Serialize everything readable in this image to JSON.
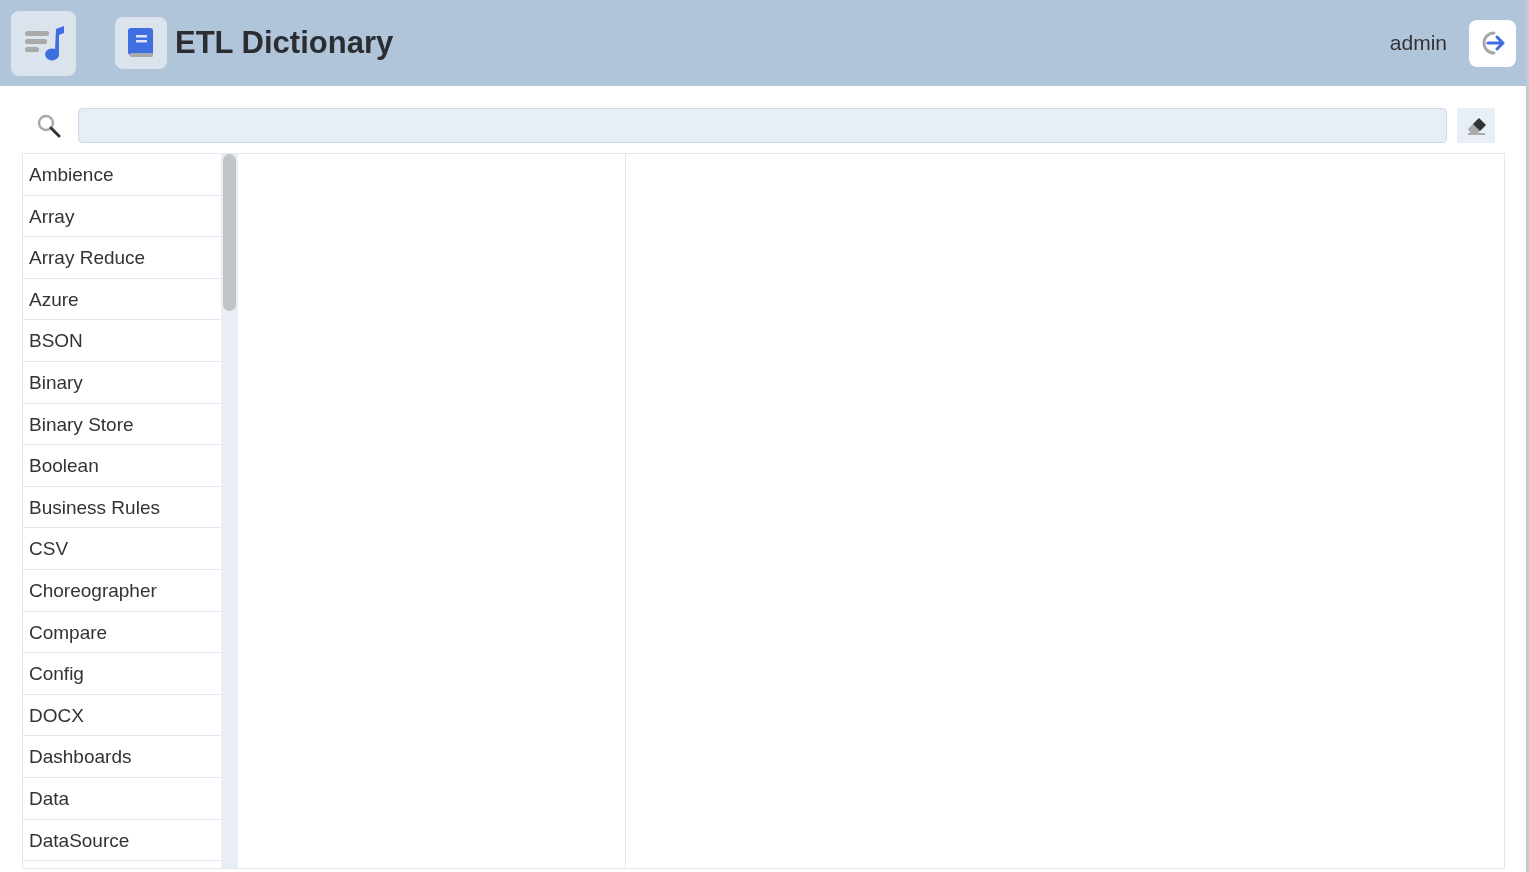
{
  "header": {
    "title": "ETL Dictionary",
    "user": "admin"
  },
  "items": [
    {
      "label": "Ambience",
      "selected": false
    },
    {
      "label": "Array",
      "selected": false
    },
    {
      "label": "Array Reduce",
      "selected": false
    },
    {
      "label": "Azure",
      "selected": false
    },
    {
      "label": "BSON",
      "selected": false
    },
    {
      "label": "Binary",
      "selected": false
    },
    {
      "label": "Binary Store",
      "selected": false
    },
    {
      "label": "Boolean",
      "selected": false
    },
    {
      "label": "Business Rules",
      "selected": false
    },
    {
      "label": "CSV",
      "selected": false
    },
    {
      "label": "Choreographer",
      "selected": false
    },
    {
      "label": "Compare",
      "selected": false
    },
    {
      "label": "Config",
      "selected": false
    },
    {
      "label": "DOCX",
      "selected": false
    },
    {
      "label": "Dashboards",
      "selected": false
    },
    {
      "label": "Data",
      "selected": false
    },
    {
      "label": "DataSource",
      "selected": false
    }
  ]
}
